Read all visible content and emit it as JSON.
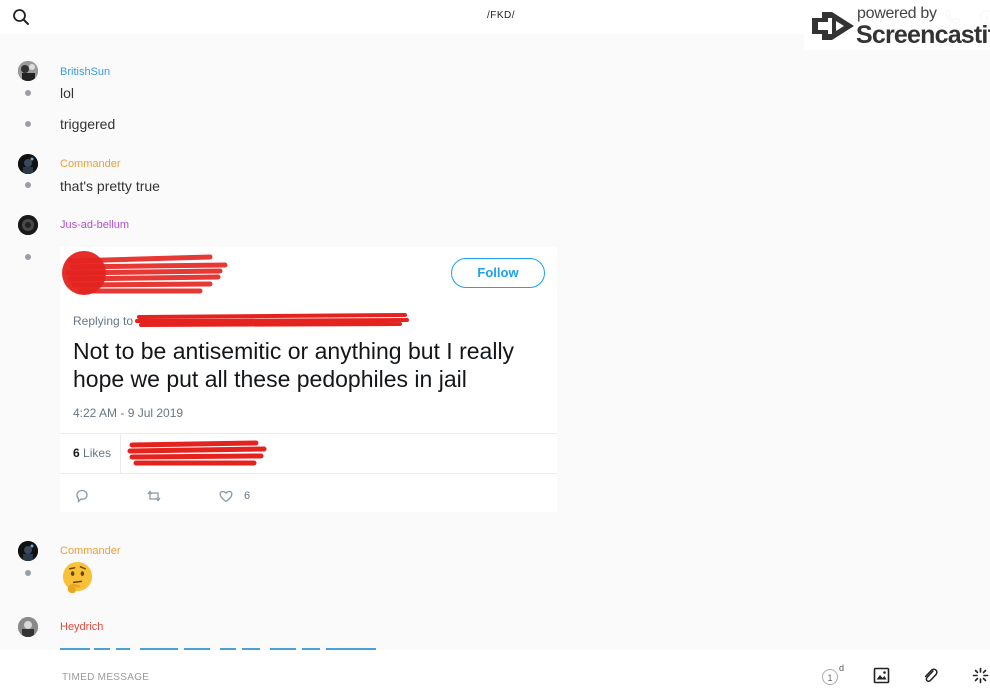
{
  "header": {
    "channel_title": "/FKD/",
    "watermark_small": "powered by",
    "watermark_big": "Screencastify"
  },
  "messages": [
    {
      "user": "BritishSun",
      "user_color": "#3a9bd9",
      "lines": [
        "lol",
        "triggered"
      ]
    },
    {
      "user": "Commander",
      "user_color": "#e8a03a",
      "lines": [
        "that's pretty true"
      ]
    },
    {
      "user": "Jus-ad-bellum",
      "user_color": "#b54fd1",
      "lines": []
    },
    {
      "user": "Commander",
      "user_color": "#e8a03a",
      "lines": []
    },
    {
      "user": "Heydrich",
      "user_color": "#e0493f",
      "lines": []
    }
  ],
  "tweet": {
    "follow_label": "Follow",
    "replying_label": "Replying to",
    "text": "Not to be antisemitic or anything but I really hope we put all these pedophiles in jail",
    "timestamp": "4:22 AM - 9 Jul 2019",
    "likes_count": "6",
    "likes_label": "Likes",
    "heart_count": "6"
  },
  "composer": {
    "placeholder": "TIMED MESSAGE",
    "timer_value": "1",
    "timer_unit": "d"
  },
  "colors": {
    "tweet_blue": "#1da1f2",
    "redaction_red": "#e4231f",
    "dot_gray": "#9a9ea6"
  },
  "icons": [
    "search-icon",
    "phone-icon",
    "info-icon",
    "reply-icon",
    "retweet-icon",
    "heart-icon",
    "thinking-face-emoji",
    "timer-icon",
    "image-icon",
    "paperclip-icon",
    "sparkle-icon"
  ]
}
